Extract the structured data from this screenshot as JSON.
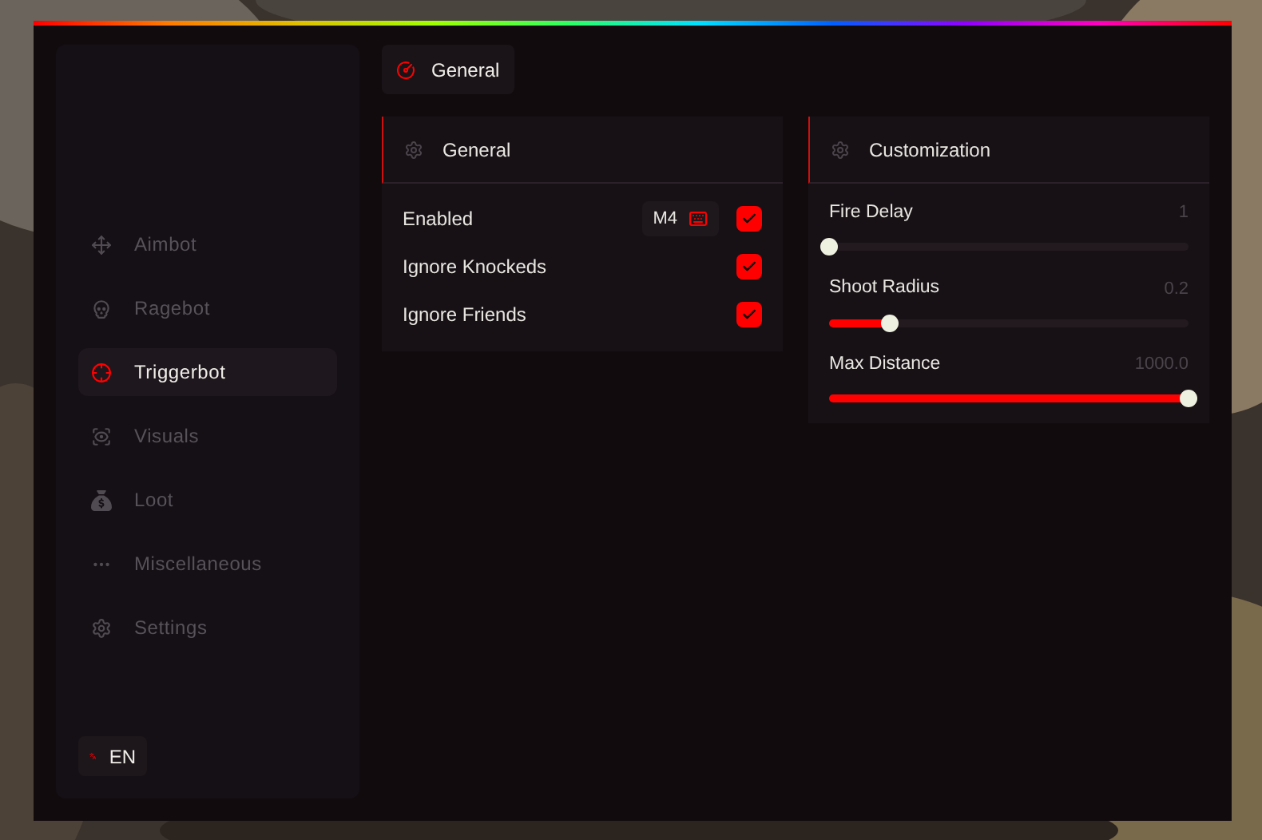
{
  "sidebar": {
    "items": [
      {
        "label": "Aimbot",
        "selected": false
      },
      {
        "label": "Ragebot",
        "selected": false
      },
      {
        "label": "Triggerbot",
        "selected": true
      },
      {
        "label": "Visuals",
        "selected": false
      },
      {
        "label": "Loot",
        "selected": false
      },
      {
        "label": "Miscellaneous",
        "selected": false
      },
      {
        "label": "Settings",
        "selected": false
      }
    ],
    "language": "EN"
  },
  "tabs": [
    {
      "label": "General",
      "selected": true
    }
  ],
  "general": {
    "title": "General",
    "options": [
      {
        "label": "Enabled",
        "keybind": "M4",
        "checked": true
      },
      {
        "label": "Ignore Knockeds",
        "checked": true
      },
      {
        "label": "Ignore Friends",
        "checked": true
      }
    ]
  },
  "customization": {
    "title": "Customization",
    "sliders": [
      {
        "label": "Fire Delay",
        "reading": "1",
        "level": 0
      },
      {
        "label": "Shoot Radius",
        "reading": "0.2",
        "level": 0.17
      },
      {
        "label": "Max Distance",
        "reading": "1000.0",
        "level": 1
      }
    ]
  }
}
